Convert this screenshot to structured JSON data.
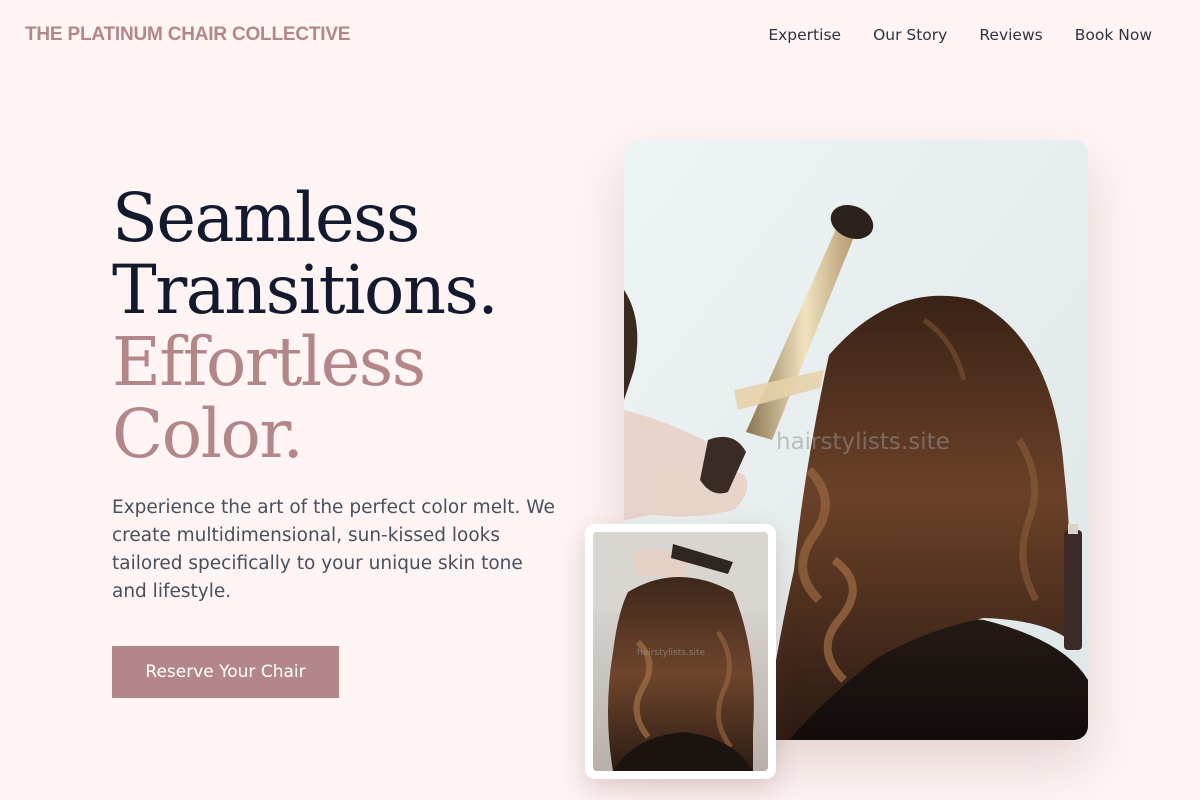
{
  "header": {
    "brand": "THE PLATINUM CHAIR COLLECTIVE",
    "nav": [
      "Expertise",
      "Our Story",
      "Reviews",
      "Book Now"
    ]
  },
  "hero": {
    "headline_lines": [
      "Seamless",
      "Transitions.",
      "Effortless",
      "Color."
    ],
    "description": "Experience the art of the perfect color melt. We create multidimensional, sun-kissed looks tailored specifically to your unique skin tone and lifestyle.",
    "cta_label": "Reserve Your Chair"
  },
  "images": {
    "main_watermark": "hairstylists.site",
    "inset_watermark": "hairstylists.site"
  },
  "colors": {
    "background": "#fdf4f3",
    "accent": "#b3868a",
    "headline_dark": "#141a2e",
    "body_text": "#4a4f5c"
  }
}
